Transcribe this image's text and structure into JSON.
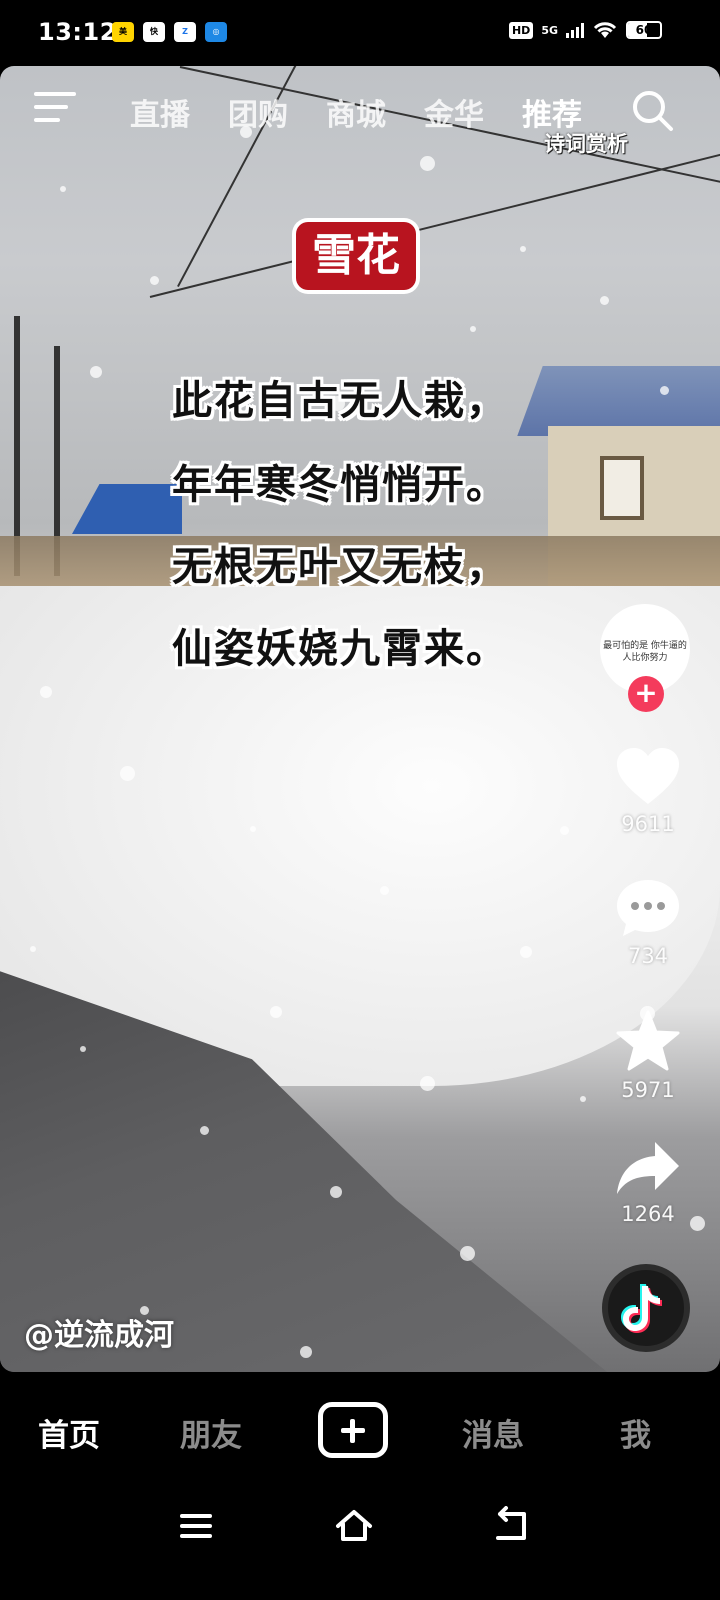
{
  "status_bar": {
    "time": "13:12",
    "app_icons": [
      "meituan-icon",
      "kuaidi-icon",
      "app-z-icon",
      "app-blue-icon"
    ],
    "hd": "HD",
    "network": "5G",
    "battery": "60",
    "battery_level": 0.6
  },
  "top_nav": {
    "tabs": [
      "直播",
      "团购",
      "商城",
      "金华",
      "推荐"
    ],
    "active_tab": "推荐",
    "active_subtitle": "诗词赏析"
  },
  "poem": {
    "title": "雪花",
    "lines": [
      "此花自古无人栽，",
      "年年寒冬悄悄开。",
      "无根无叶又无枝，",
      "仙姿妖娆九霄来。"
    ]
  },
  "author": {
    "handle": "@逆流成河",
    "avatar_text": "最可怕的是 你牛逼的人比你努力"
  },
  "actions": {
    "likes": "9611",
    "comments": "734",
    "favorites": "5971",
    "shares": "1264"
  },
  "bottom_tabs": {
    "home": "首页",
    "friends": "朋友",
    "messages": "消息",
    "me": "我",
    "active": "首页"
  },
  "colors": {
    "accent": "#f43b5c",
    "title_badge": "#b8141f",
    "background": "#000000"
  }
}
